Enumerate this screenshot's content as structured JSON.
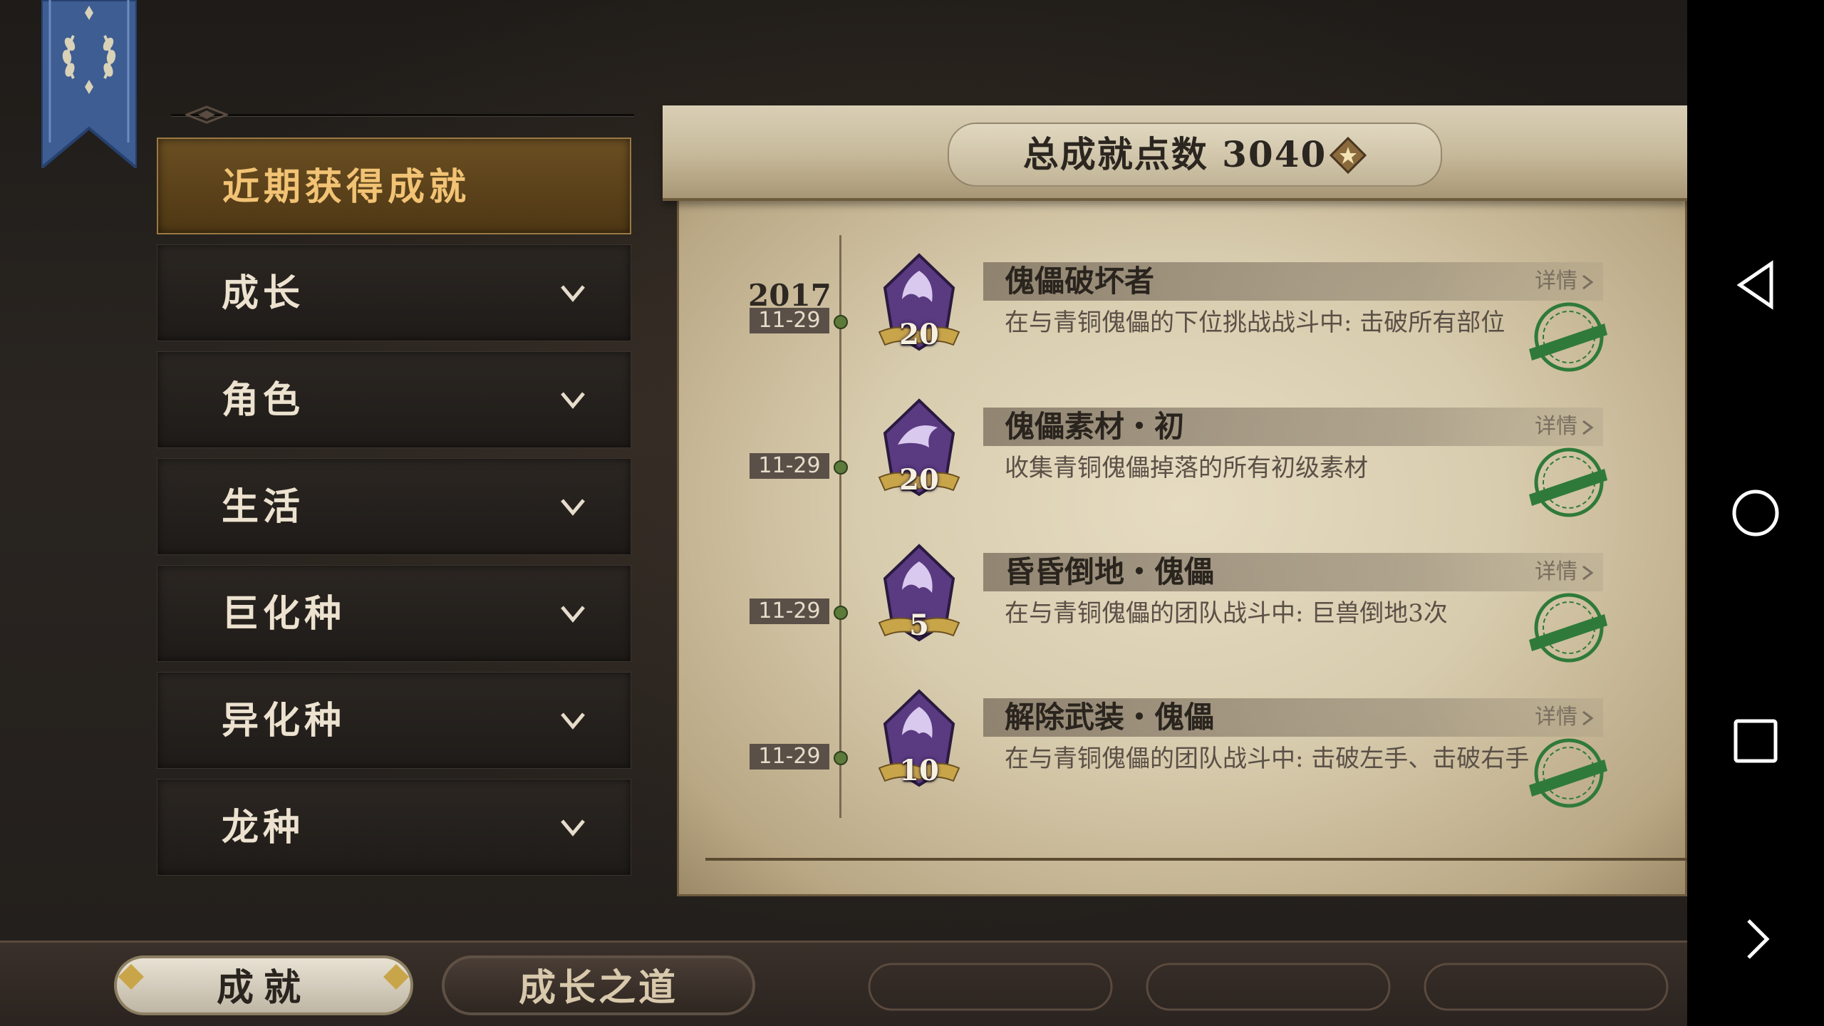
{
  "menu": {
    "items": [
      {
        "label": "近期获得成就",
        "active": true
      },
      {
        "label": "成长"
      },
      {
        "label": "角色"
      },
      {
        "label": "生活"
      },
      {
        "label": "巨化种"
      },
      {
        "label": "异化种"
      },
      {
        "label": "龙种"
      }
    ]
  },
  "scroll": {
    "title": "总成就点数 3040",
    "year": "2017",
    "entries": [
      {
        "date": "11-29",
        "points": "20",
        "title": "傀儡破坏者",
        "details": "详情",
        "desc": "在与青铜傀儡的下位挑战战斗中: 击破所有部位"
      },
      {
        "date": "11-29",
        "points": "20",
        "title": "傀儡素材・初",
        "details": "详情",
        "desc": "收集青铜傀儡掉落的所有初级素材"
      },
      {
        "date": "11-29",
        "points": "5",
        "title": "昏昏倒地・傀儡",
        "details": "详情",
        "desc": "在与青铜傀儡的团队战斗中: 巨兽倒地3次"
      },
      {
        "date": "11-29",
        "points": "10",
        "title": "解除武装・傀儡",
        "details": "详情",
        "desc": "在与青铜傀儡的团队战斗中: 击破左手、击破右手"
      }
    ]
  },
  "bottom_tabs": {
    "achievements": "成就",
    "growth": "成长之道"
  },
  "icons": {
    "banner": "laurel-banner-icon",
    "gem": "achievement-point-gem-icon",
    "medal": "dragon-medal-icon",
    "stamp": "achieved-stamp-icon",
    "nav_back": "back-triangle-icon",
    "nav_home": "home-circle-icon",
    "nav_recents": "recents-square-icon",
    "nav_expand": "chevron-right-icon"
  },
  "colors": {
    "active_menu": "#6b4f22",
    "active_menu_text": "#f2c374",
    "stamp_green": "#2f7a3a",
    "medal_purple": "#5a3a80"
  }
}
